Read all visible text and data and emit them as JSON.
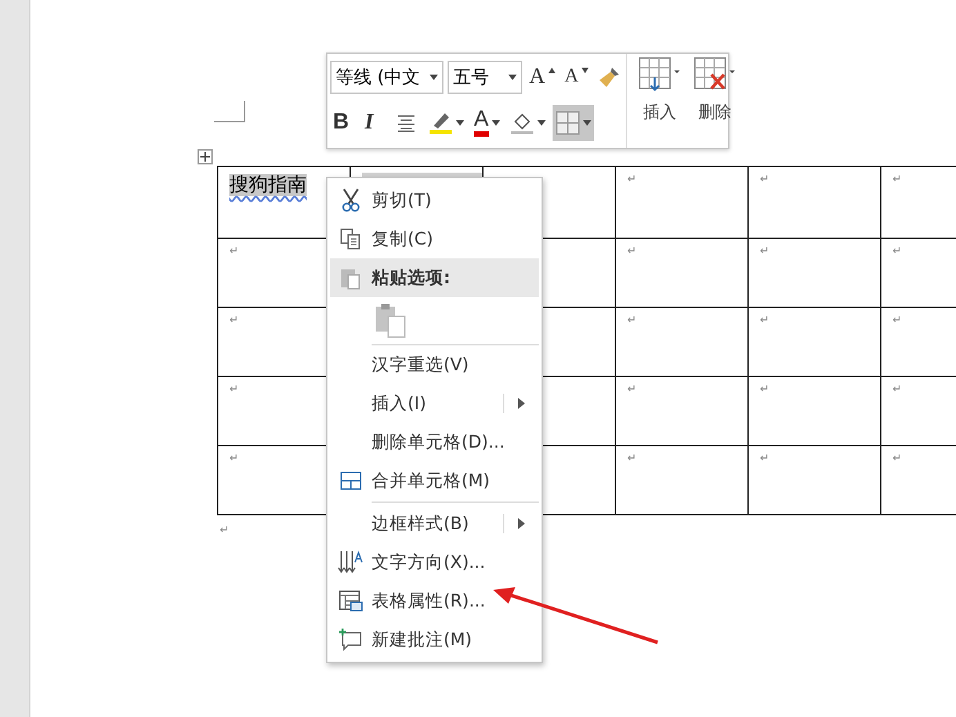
{
  "mini_toolbar": {
    "font": "等线 (中文",
    "size": "五号",
    "buttons": [
      {
        "kind": "grow-font",
        "label": "A"
      },
      {
        "kind": "shrink-font",
        "label": "A"
      },
      {
        "kind": "format-painter"
      },
      {
        "kind": "bold",
        "label": "B"
      },
      {
        "kind": "italic",
        "label": "I"
      },
      {
        "kind": "align"
      },
      {
        "kind": "highlight"
      },
      {
        "kind": "font-color",
        "label": "A"
      },
      {
        "kind": "shading"
      },
      {
        "kind": "borders",
        "selected": true
      }
    ],
    "insert": "插入",
    "delete": "删除"
  },
  "table": {
    "first_cell_selected": true,
    "rows": [
      {
        "cells": [
          "搜狗指南",
          null,
          null,
          "↵",
          "↵",
          "↵"
        ]
      },
      {
        "cells": [
          "↵",
          null,
          null,
          "↵",
          "↵",
          "↵"
        ]
      },
      {
        "cells": [
          "↵",
          null,
          null,
          "↵",
          "↵",
          "↵"
        ]
      },
      {
        "cells": [
          "↵",
          null,
          null,
          "↵",
          "↵",
          "↵"
        ]
      },
      {
        "cells": [
          "↵",
          null,
          null,
          "↵",
          "↵",
          "↵"
        ]
      }
    ],
    "after_mark": "↵"
  },
  "context_menu": [
    {
      "kind": "item",
      "label": "剪切(T)"
    },
    {
      "kind": "item",
      "label": "复制(C)"
    },
    {
      "kind": "header",
      "label": "粘贴选项:"
    },
    {
      "kind": "paste-options"
    },
    {
      "kind": "item",
      "label": "汉字重选(V)"
    },
    {
      "kind": "item",
      "label": "插入(I)",
      "submenu": true
    },
    {
      "kind": "item",
      "label": "删除单元格(D)..."
    },
    {
      "kind": "item",
      "label": "合并单元格(M)"
    },
    {
      "kind": "item",
      "label": "边框样式(B)",
      "submenu": true
    },
    {
      "kind": "item",
      "label": "文字方向(X)..."
    },
    {
      "kind": "item",
      "label": "表格属性(R)..."
    },
    {
      "kind": "item",
      "label": "新建批注(M)"
    }
  ]
}
